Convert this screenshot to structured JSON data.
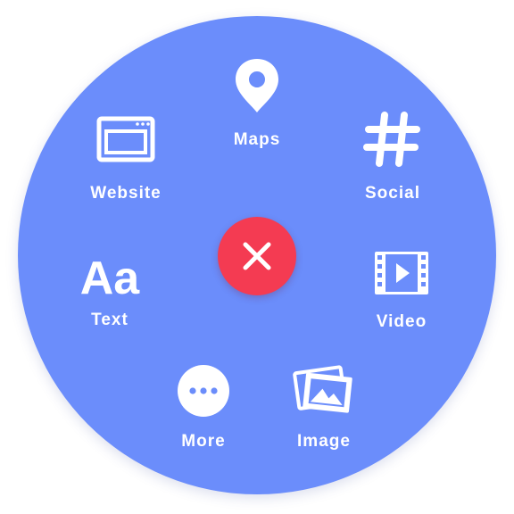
{
  "colors": {
    "menu_background": "#6b8dfb",
    "close_button": "#f43b52",
    "foreground": "#ffffff"
  },
  "menu": {
    "items": [
      {
        "label": "Maps",
        "icon": "map-pin-icon"
      },
      {
        "label": "Social",
        "icon": "hashtag-icon"
      },
      {
        "label": "Video",
        "icon": "film-strip-icon"
      },
      {
        "label": "Image",
        "icon": "photo-stack-icon"
      },
      {
        "label": "More",
        "icon": "more-dots-icon"
      },
      {
        "label": "Text",
        "icon": "text-icon",
        "glyph": "Aa"
      },
      {
        "label": "Website",
        "icon": "browser-window-icon"
      }
    ],
    "close_icon": "close-icon"
  }
}
